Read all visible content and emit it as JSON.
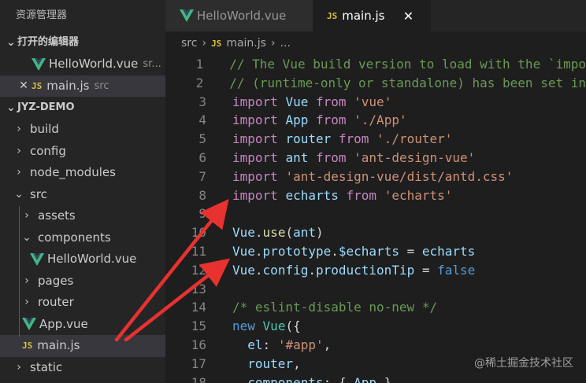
{
  "sidebar": {
    "title": "资源管理器",
    "open_editors_header": "打开的编辑器",
    "open_editors": [
      {
        "name": "HelloWorld.vue",
        "desc": "sr..."
      },
      {
        "name": "main.js",
        "desc": "src"
      }
    ],
    "project_header": "JYZ-DEMO",
    "tree": [
      {
        "label": "build"
      },
      {
        "label": "config"
      },
      {
        "label": "node_modules"
      },
      {
        "label": "src"
      },
      {
        "label": "assets"
      },
      {
        "label": "components"
      },
      {
        "label": "HelloWorld.vue"
      },
      {
        "label": "pages"
      },
      {
        "label": "router"
      },
      {
        "label": "App.vue"
      },
      {
        "label": "main.js"
      },
      {
        "label": "static"
      }
    ]
  },
  "tabs": [
    {
      "label": "HelloWorld.vue"
    },
    {
      "label": "main.js"
    }
  ],
  "breadcrumb": {
    "folder": "src",
    "file": "main.js",
    "more": "..."
  },
  "editor": {
    "line_numbers": [
      "1",
      "2",
      "3",
      "4",
      "5",
      "6",
      "7",
      "8",
      "9",
      "10",
      "11",
      "12",
      "13",
      "14",
      "15",
      "16",
      "17",
      "18"
    ],
    "lines": [
      "// The Vue build version to load with the `impo",
      "// (runtime-only or standalone) has been set in",
      "import Vue from 'vue'",
      "import App from './App'",
      "import router from './router'",
      "import ant from 'ant-design-vue'",
      "import 'ant-design-vue/dist/antd.css'",
      "import echarts from 'echarts'",
      "",
      "Vue.use(ant)",
      "Vue.prototype.$echarts = echarts",
      "Vue.config.productionTip = false",
      "",
      "/* eslint-disable no-new */",
      "new Vue({",
      "  el: '#app',",
      "  router,",
      "  components: { App }"
    ]
  },
  "watermark": "@稀土掘金技术社区",
  "colors": {
    "arrow": "#e8322f",
    "vue_green": "#41b883",
    "js_yellow": "#d4c23e"
  }
}
